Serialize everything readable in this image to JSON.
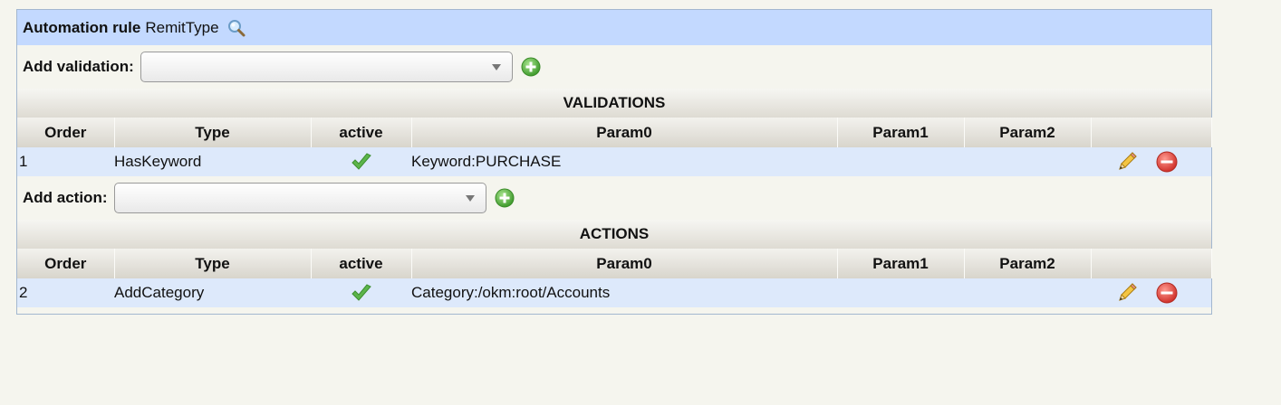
{
  "header": {
    "label": "Automation rule",
    "rule_name": "RemitType",
    "search_icon": "search-icon"
  },
  "validation_adder": {
    "label": "Add validation:",
    "selected_value": "",
    "add_icon": "add-icon"
  },
  "validations": {
    "title": "VALIDATIONS",
    "columns": [
      "Order",
      "Type",
      "active",
      "Param0",
      "Param1",
      "Param2",
      ""
    ],
    "rows": [
      {
        "order": "1",
        "type": "HasKeyword",
        "active": true,
        "param0": "Keyword:PURCHASE",
        "param1": "",
        "param2": ""
      }
    ]
  },
  "action_adder": {
    "label": "Add action:",
    "selected_value": "",
    "add_icon": "add-icon"
  },
  "actions": {
    "title": "ACTIONS",
    "columns": [
      "Order",
      "Type",
      "active",
      "Param0",
      "Param1",
      "Param2",
      ""
    ],
    "rows": [
      {
        "order": "2",
        "type": "AddCategory",
        "active": true,
        "param0": "Category:/okm:root/Accounts",
        "param1": "",
        "param2": ""
      }
    ]
  },
  "icons": {
    "active": "check-icon",
    "edit": "pencil-icon",
    "delete": "delete-icon"
  },
  "colors": {
    "title_bar": "#c3d9ff",
    "row_highlight": "#dde9fb",
    "background": "#f5f5ee"
  }
}
